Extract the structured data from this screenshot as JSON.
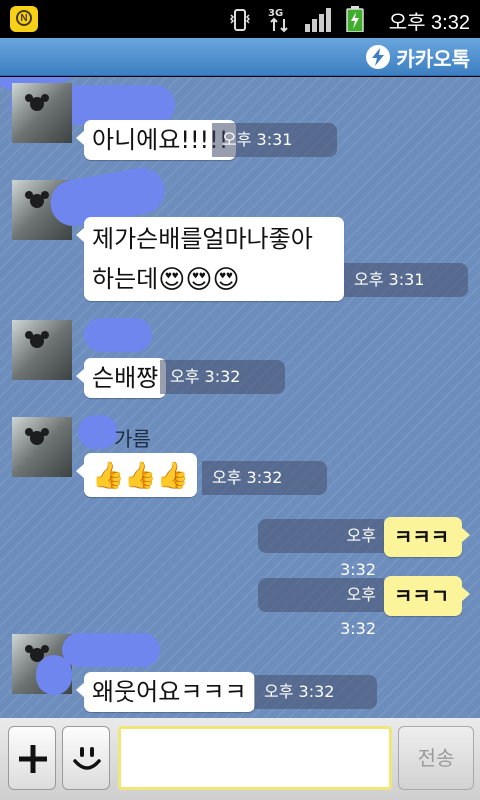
{
  "status_bar": {
    "time": "오후 3:32",
    "notification_icon": "naver-app-icon",
    "icons": [
      "vibrate-icon",
      "3g-data-icon",
      "signal-icon",
      "battery-charging-icon"
    ]
  },
  "title_bar": {
    "app_name": "카카오톡",
    "logo_icon": "kakao-bolt-icon"
  },
  "messages": [
    {
      "side": "in",
      "text": "아니에요!!!!!",
      "time": "오후 3:31"
    },
    {
      "side": "in",
      "line1": "제가슨배를얼마나좋아",
      "line2": "하는데",
      "emoji": "😍😍😍",
      "time": "오후 3:31"
    },
    {
      "side": "in",
      "text": "슨배쨩",
      "time": "오후 3:32"
    },
    {
      "side": "in",
      "sender_visible": "가름",
      "emoji": "👍👍👍",
      "time": "오후 3:32"
    },
    {
      "side": "out",
      "text": "ㅋㅋㅋ",
      "time": "오후 3:32"
    },
    {
      "side": "out",
      "text": "ㅋㅋㄱ",
      "time": "오후 3:32"
    },
    {
      "side": "in",
      "text": "왜웃어요ㅋㅋㅋ",
      "time": "오후 3:32"
    }
  ],
  "input_bar": {
    "plus_label": "+",
    "emoticon_icon": "smiley-icon",
    "message_value": "",
    "send_label": "전송"
  },
  "colors": {
    "chat_background": "#6d8ebd",
    "outgoing_bubble": "#fbf49a",
    "title_bar": "#4f90d0"
  }
}
